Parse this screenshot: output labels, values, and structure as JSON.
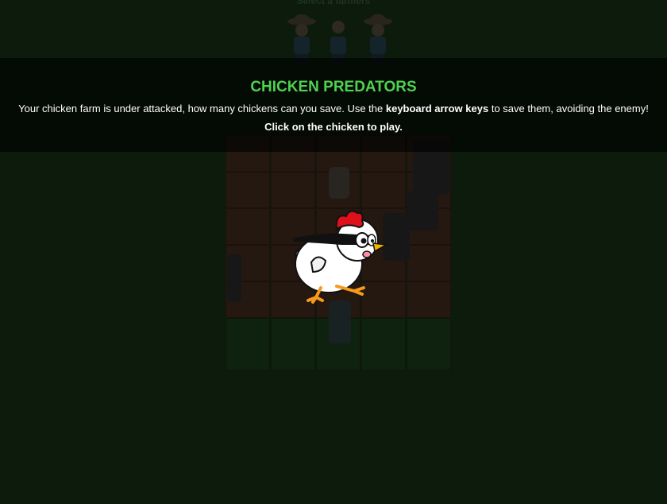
{
  "header": {
    "select_label": "Select a farmers"
  },
  "intro": {
    "title": "CHICKEN PREDATORS",
    "desc_before": "Your chicken farm is under attacked, how many chickens can you save. Use the ",
    "desc_keys": "keyboard arrow keys",
    "desc_after": " to save them, avoiding the enemy!",
    "cta": "Click on the chicken to play."
  },
  "farmers": [
    {
      "name": "farmer-1"
    },
    {
      "name": "farmer-2"
    },
    {
      "name": "farmer-3"
    }
  ],
  "board": {
    "dirt_rows": 5,
    "grass_rows": 1,
    "columns": 5
  },
  "colors": {
    "title": "#4fd24f",
    "background": "#0d1b0d",
    "chicken_comb": "#e0101a",
    "chicken_beak": "#f5b400",
    "chicken_mask": "#111111"
  },
  "icons": {
    "start": "chicken-icon"
  }
}
